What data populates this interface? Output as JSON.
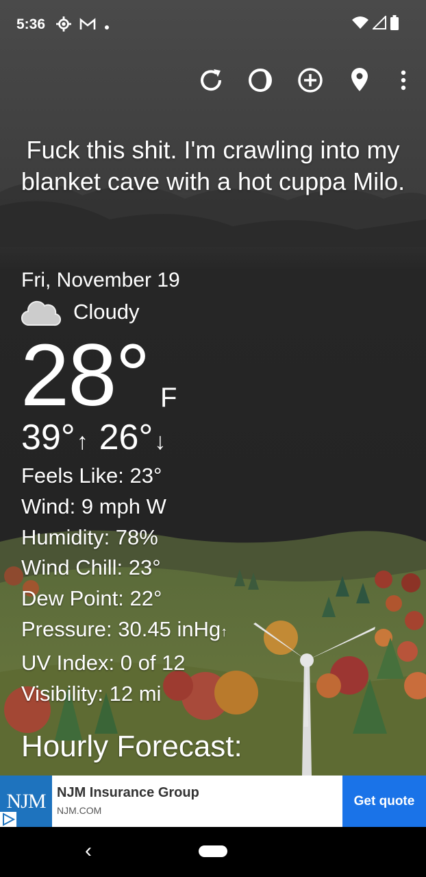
{
  "status": {
    "time": "5:36",
    "left_icons": [
      "settings-icon",
      "gmail-icon",
      "dot-icon"
    ],
    "right_icons": [
      "wifi-icon",
      "signal-icon",
      "battery-icon"
    ]
  },
  "toolbar": {
    "icons": [
      "refresh-icon",
      "theme-icon",
      "add-location-icon",
      "location-pin-icon",
      "more-icon"
    ]
  },
  "quote": "Fuck this shit. I'm crawling into my blanket cave with a hot cuppa Milo.",
  "weather": {
    "date": "Fri, November 19",
    "condition": "Cloudy",
    "condition_icon": "cloud-icon",
    "temp": "28°",
    "unit": "F",
    "high": "39°",
    "high_arrow": "↑",
    "low": "26°",
    "low_arrow": "↓"
  },
  "details": {
    "feels_like": "Feels Like:  23°",
    "wind": "Wind:  9 mph W",
    "humidity": "Humidity:  78%",
    "wind_chill": "Wind Chill:  23°",
    "dew_point": "Dew Point:  22°",
    "pressure": "Pressure:  30.45 inHg",
    "pressure_arrow": "↑",
    "uv_index": "UV Index:  0 of 12",
    "visibility": "Visibility:  12 mi"
  },
  "hourly_title": "Hourly Forecast:",
  "ad": {
    "logo": "NJM",
    "title": "NJM Insurance Group",
    "url": "NJM.COM",
    "cta": "Get quote"
  },
  "nav": {
    "back": "‹"
  }
}
